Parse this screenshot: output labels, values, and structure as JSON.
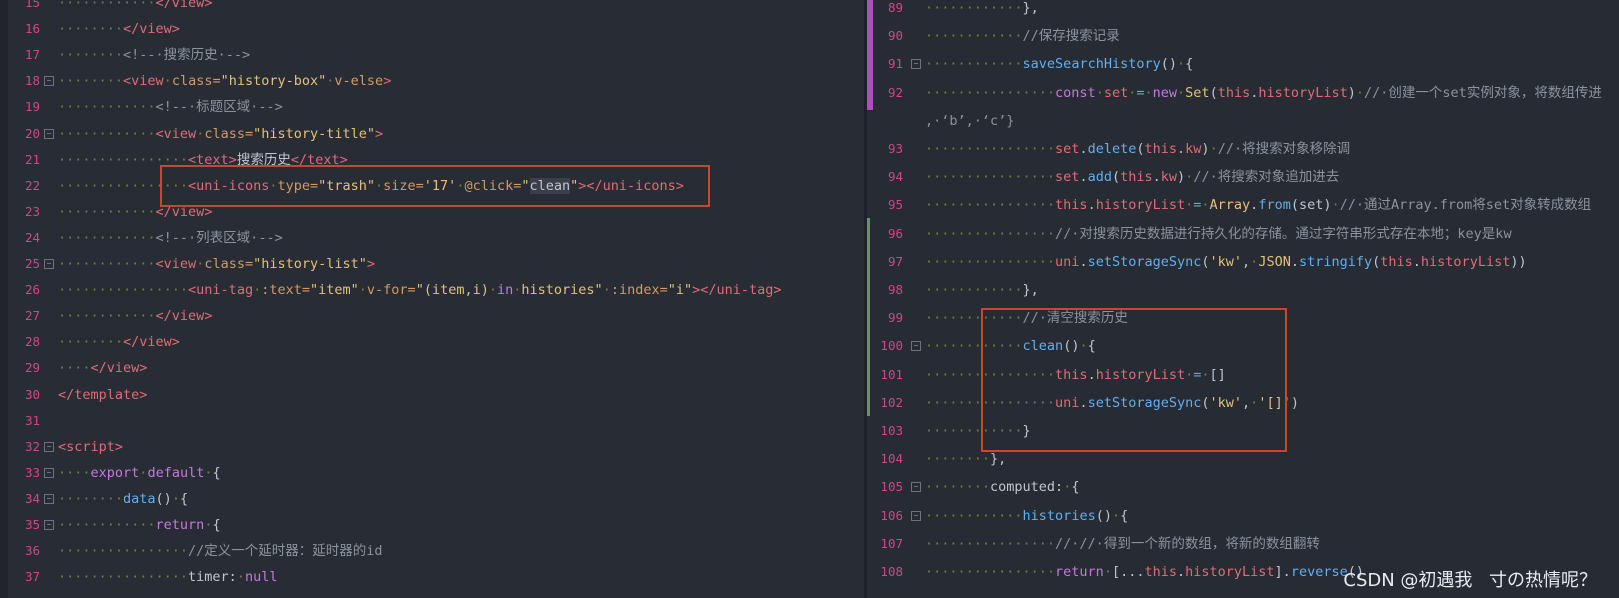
{
  "left": {
    "lines": [
      {
        "n": "15",
        "segs": [
          [
            "dot",
            "············"
          ],
          [
            "tag",
            "</view>"
          ]
        ]
      },
      {
        "n": "16",
        "segs": [
          [
            "dot",
            "········"
          ],
          [
            "tag",
            "</view>"
          ]
        ]
      },
      {
        "n": "17",
        "segs": [
          [
            "dot",
            "········"
          ],
          [
            "cmt",
            "<!--·搜索历史·-->"
          ]
        ]
      },
      {
        "n": "18",
        "fold": true,
        "segs": [
          [
            "dot",
            "········"
          ],
          [
            "tag",
            "<view"
          ],
          [
            "dot",
            "·"
          ],
          [
            "attr",
            "class="
          ],
          [
            "str",
            "\"history-box\""
          ],
          [
            "dot",
            "·"
          ],
          [
            "attr",
            "v-else"
          ],
          [
            "tag",
            ">"
          ]
        ]
      },
      {
        "n": "19",
        "segs": [
          [
            "dot",
            "············"
          ],
          [
            "cmt",
            "<!--·标题区域·-->"
          ]
        ]
      },
      {
        "n": "20",
        "fold": true,
        "segs": [
          [
            "dot",
            "············"
          ],
          [
            "tag",
            "<view"
          ],
          [
            "dot",
            "·"
          ],
          [
            "attr",
            "class="
          ],
          [
            "str",
            "\"history-title\""
          ],
          [
            "tag",
            ">"
          ]
        ]
      },
      {
        "n": "21",
        "segs": [
          [
            "dot",
            "················"
          ],
          [
            "tag",
            "<text>"
          ],
          [
            "plain",
            "搜索历史"
          ],
          [
            "tag",
            "</text>"
          ]
        ]
      },
      {
        "n": "22",
        "segs": [
          [
            "dot",
            "················"
          ],
          [
            "tag",
            "<uni-icons"
          ],
          [
            "dot",
            "·"
          ],
          [
            "attr",
            "type="
          ],
          [
            "str",
            "\"trash\""
          ],
          [
            "dot",
            "·"
          ],
          [
            "attr",
            "size="
          ],
          [
            "str",
            "'17'"
          ],
          [
            "dot",
            "·"
          ],
          [
            "attr",
            "@click="
          ],
          [
            "str",
            "\""
          ],
          [
            "hl",
            "clean"
          ],
          [
            "str",
            "\""
          ],
          [
            "tag",
            "></uni-icons>"
          ]
        ]
      },
      {
        "n": "23",
        "segs": [
          [
            "dot",
            "············"
          ],
          [
            "tag",
            "</view>"
          ]
        ]
      },
      {
        "n": "24",
        "segs": [
          [
            "dot",
            "············"
          ],
          [
            "cmt",
            "<!--·列表区域·-->"
          ]
        ]
      },
      {
        "n": "25",
        "fold": true,
        "segs": [
          [
            "dot",
            "············"
          ],
          [
            "tag",
            "<view"
          ],
          [
            "dot",
            "·"
          ],
          [
            "attr",
            "class="
          ],
          [
            "str",
            "\"history-list\""
          ],
          [
            "tag",
            ">"
          ]
        ]
      },
      {
        "n": "26",
        "segs": [
          [
            "dot",
            "················"
          ],
          [
            "tag",
            "<uni-tag"
          ],
          [
            "dot",
            "·"
          ],
          [
            "attr",
            ":text="
          ],
          [
            "str",
            "\"item\""
          ],
          [
            "dot",
            "·"
          ],
          [
            "attr",
            "v-for="
          ],
          [
            "str",
            "\"(item,i)"
          ],
          [
            "dot",
            "·"
          ],
          [
            "kw",
            "in"
          ],
          [
            "dot",
            "·"
          ],
          [
            "str",
            "histories\""
          ],
          [
            "dot",
            "·"
          ],
          [
            "attr",
            ":index="
          ],
          [
            "str",
            "\"i\""
          ],
          [
            "tag",
            "></uni-tag>"
          ]
        ]
      },
      {
        "n": "27",
        "segs": [
          [
            "dot",
            "············"
          ],
          [
            "tag",
            "</view>"
          ]
        ]
      },
      {
        "n": "28",
        "segs": [
          [
            "dot",
            "········"
          ],
          [
            "tag",
            "</view>"
          ]
        ]
      },
      {
        "n": "29",
        "segs": [
          [
            "dot",
            "····"
          ],
          [
            "tag",
            "</view>"
          ]
        ]
      },
      {
        "n": "30",
        "segs": [
          [
            "tag",
            "</template>"
          ]
        ]
      },
      {
        "n": "31",
        "segs": []
      },
      {
        "n": "32",
        "fold": true,
        "segs": [
          [
            "tag",
            "<script>"
          ]
        ]
      },
      {
        "n": "33",
        "fold": true,
        "segs": [
          [
            "dot",
            "····"
          ],
          [
            "kw",
            "export"
          ],
          [
            "dot",
            "·"
          ],
          [
            "kw",
            "default"
          ],
          [
            "dot",
            "·"
          ],
          [
            "plain",
            "{"
          ]
        ]
      },
      {
        "n": "34",
        "fold": true,
        "segs": [
          [
            "dot",
            "········"
          ],
          [
            "fn",
            "data"
          ],
          [
            "plain",
            "()"
          ],
          [
            "dot",
            "·"
          ],
          [
            "plain",
            "{"
          ]
        ]
      },
      {
        "n": "35",
        "fold": true,
        "segs": [
          [
            "dot",
            "············"
          ],
          [
            "kw",
            "return"
          ],
          [
            "dot",
            "·"
          ],
          [
            "plain",
            "{"
          ]
        ]
      },
      {
        "n": "36",
        "segs": [
          [
            "dot",
            "················"
          ],
          [
            "cmt",
            "//定义一个延时器：延时器的id"
          ]
        ]
      },
      {
        "n": "37",
        "segs": [
          [
            "dot",
            "················"
          ],
          [
            "plain",
            "timer:"
          ],
          [
            "dot",
            "·"
          ],
          [
            "kw",
            "null"
          ]
        ]
      }
    ]
  },
  "right": {
    "lines": [
      {
        "n": "89",
        "segs": [
          [
            "dot",
            "············"
          ],
          [
            "plain",
            "},"
          ]
        ]
      },
      {
        "n": "90",
        "segs": [
          [
            "dot",
            "············"
          ],
          [
            "cmt",
            "//保存搜索记录"
          ]
        ]
      },
      {
        "n": "91",
        "fold": true,
        "segs": [
          [
            "dot",
            "············"
          ],
          [
            "fn",
            "saveSearchHistory"
          ],
          [
            "plain",
            "()"
          ],
          [
            "dot",
            "·"
          ],
          [
            "plain",
            "{"
          ]
        ]
      },
      {
        "n": "92",
        "segs": [
          [
            "dot",
            "················"
          ],
          [
            "kw",
            "const"
          ],
          [
            "dot",
            "·"
          ],
          [
            "this",
            "set"
          ],
          [
            "dot",
            "·"
          ],
          [
            "op",
            "="
          ],
          [
            "dot",
            "·"
          ],
          [
            "kw",
            "new"
          ],
          [
            "dot",
            "·"
          ],
          [
            "str",
            "Set"
          ],
          [
            "plain",
            "("
          ],
          [
            "this",
            "this"
          ],
          [
            "plain",
            "."
          ],
          [
            "prop",
            "historyList"
          ],
          [
            "plain",
            ")"
          ],
          [
            "dot",
            "·"
          ],
          [
            "cmt",
            "//·创建一个set实例对象，将数组传进"
          ]
        ]
      },
      {
        "n": "",
        "segs": [
          [
            "cmt",
            ",·‘b’,·‘c’}"
          ]
        ]
      },
      {
        "n": "93",
        "segs": [
          [
            "dot",
            "················"
          ],
          [
            "this",
            "set"
          ],
          [
            "plain",
            "."
          ],
          [
            "fn",
            "delete"
          ],
          [
            "plain",
            "("
          ],
          [
            "this",
            "this"
          ],
          [
            "plain",
            "."
          ],
          [
            "prop",
            "kw"
          ],
          [
            "plain",
            ")"
          ],
          [
            "dot",
            "·"
          ],
          [
            "cmt",
            "//·将搜索对象移除调"
          ]
        ]
      },
      {
        "n": "94",
        "segs": [
          [
            "dot",
            "················"
          ],
          [
            "this",
            "set"
          ],
          [
            "plain",
            "."
          ],
          [
            "fn",
            "add"
          ],
          [
            "plain",
            "("
          ],
          [
            "this",
            "this"
          ],
          [
            "plain",
            "."
          ],
          [
            "prop",
            "kw"
          ],
          [
            "plain",
            ")"
          ],
          [
            "dot",
            "·"
          ],
          [
            "cmt",
            "//·将搜索对象追加进去"
          ]
        ]
      },
      {
        "n": "95",
        "segs": [
          [
            "dot",
            "················"
          ],
          [
            "this",
            "this"
          ],
          [
            "plain",
            "."
          ],
          [
            "prop",
            "historyList"
          ],
          [
            "dot",
            "·"
          ],
          [
            "op",
            "="
          ],
          [
            "dot",
            "·"
          ],
          [
            "str",
            "Array"
          ],
          [
            "plain",
            "."
          ],
          [
            "fn",
            "from"
          ],
          [
            "plain",
            "(set)"
          ],
          [
            "dot",
            "·"
          ],
          [
            "cmt",
            "//·通过Array.from将set对象转成数组"
          ]
        ]
      },
      {
        "n": "96",
        "segs": [
          [
            "dot",
            "················"
          ],
          [
            "cmt",
            "//·对搜索历史数据进行持久化的存储。通过字符串形式存在本地；key是kw"
          ]
        ]
      },
      {
        "n": "97",
        "segs": [
          [
            "dot",
            "················"
          ],
          [
            "this",
            "uni"
          ],
          [
            "plain",
            "."
          ],
          [
            "fn",
            "setStorageSync"
          ],
          [
            "plain",
            "("
          ],
          [
            "str",
            "'kw'"
          ],
          [
            "plain",
            ","
          ],
          [
            "dot",
            "·"
          ],
          [
            "str",
            "JSON"
          ],
          [
            "plain",
            "."
          ],
          [
            "fn",
            "stringify"
          ],
          [
            "plain",
            "("
          ],
          [
            "this",
            "this"
          ],
          [
            "plain",
            "."
          ],
          [
            "prop",
            "historyList"
          ],
          [
            "plain",
            "))"
          ]
        ]
      },
      {
        "n": "98",
        "segs": [
          [
            "dot",
            "············"
          ],
          [
            "plain",
            "},"
          ]
        ]
      },
      {
        "n": "99",
        "segs": [
          [
            "dot",
            "············"
          ],
          [
            "cmt",
            "//·清空搜索历史"
          ]
        ]
      },
      {
        "n": "100",
        "fold": true,
        "segs": [
          [
            "dot",
            "············"
          ],
          [
            "fn",
            "clean"
          ],
          [
            "plain",
            "()"
          ],
          [
            "dot",
            "·"
          ],
          [
            "plain",
            "{"
          ]
        ]
      },
      {
        "n": "101",
        "segs": [
          [
            "dot",
            "················"
          ],
          [
            "this",
            "this"
          ],
          [
            "plain",
            "."
          ],
          [
            "prop",
            "historyList"
          ],
          [
            "dot",
            "·"
          ],
          [
            "op",
            "="
          ],
          [
            "dot",
            "·"
          ],
          [
            "plain",
            "[]"
          ]
        ]
      },
      {
        "n": "102",
        "segs": [
          [
            "dot",
            "················"
          ],
          [
            "this",
            "uni"
          ],
          [
            "plain",
            "."
          ],
          [
            "fn",
            "setStorageSync"
          ],
          [
            "plain",
            "("
          ],
          [
            "str",
            "'kw'"
          ],
          [
            "plain",
            ","
          ],
          [
            "dot",
            "·"
          ],
          [
            "str",
            "'[]'"
          ],
          [
            "plain",
            ")"
          ]
        ]
      },
      {
        "n": "103",
        "segs": [
          [
            "dot",
            "············"
          ],
          [
            "plain",
            "}"
          ]
        ]
      },
      {
        "n": "104",
        "segs": [
          [
            "dot",
            "········"
          ],
          [
            "plain",
            "},"
          ]
        ]
      },
      {
        "n": "105",
        "fold": true,
        "segs": [
          [
            "dot",
            "········"
          ],
          [
            "plain",
            "computed:"
          ],
          [
            "dot",
            "·"
          ],
          [
            "plain",
            "{"
          ]
        ]
      },
      {
        "n": "106",
        "fold": true,
        "segs": [
          [
            "dot",
            "············"
          ],
          [
            "fn",
            "histories"
          ],
          [
            "plain",
            "()"
          ],
          [
            "dot",
            "·"
          ],
          [
            "plain",
            "{"
          ]
        ]
      },
      {
        "n": "107",
        "segs": [
          [
            "dot",
            "················"
          ],
          [
            "cmt",
            "//·//·得到一个新的数组，将新的数组翻转"
          ]
        ]
      },
      {
        "n": "108",
        "segs": [
          [
            "dot",
            "················"
          ],
          [
            "kw",
            "return"
          ],
          [
            "dot",
            "·"
          ],
          [
            "plain",
            "[..."
          ],
          [
            "this",
            "this"
          ],
          [
            "plain",
            "."
          ],
          [
            "prop",
            "historyList"
          ],
          [
            "plain",
            "]."
          ],
          [
            "fn",
            "reverse"
          ],
          [
            "plain",
            "()"
          ]
        ]
      }
    ]
  },
  "watermark": "CSDN @初遇我ㅤ寸の热情呢？"
}
